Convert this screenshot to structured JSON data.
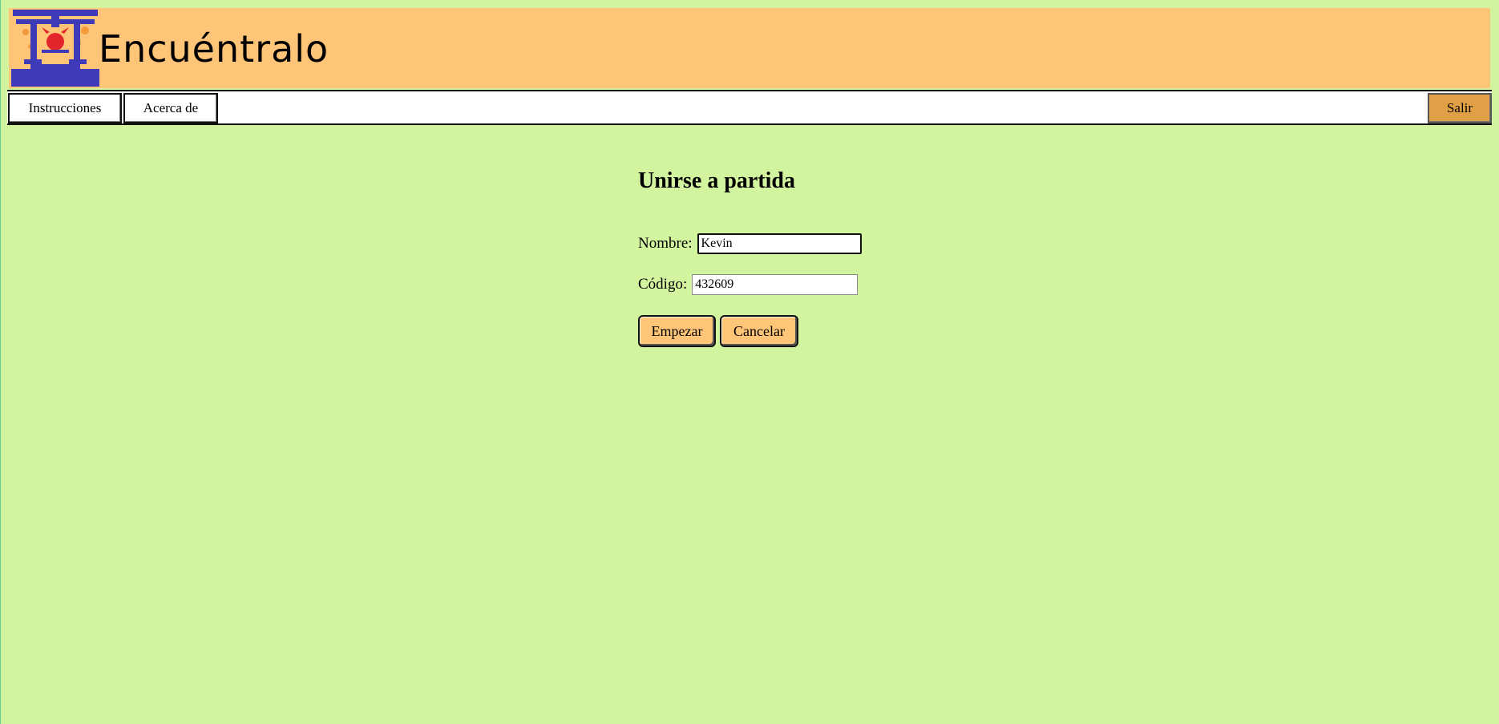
{
  "header": {
    "brand": "Encuéntralo",
    "logo_icon": "torii-gate-logo-icon"
  },
  "nav": {
    "instructions": "Instrucciones",
    "about": "Acerca de",
    "exit": "Salir"
  },
  "form": {
    "title": "Unirse a partida",
    "name_label": "Nombre:",
    "name_value": "Kevin",
    "code_label": "Código:",
    "code_value": "432609",
    "start_label": "Empezar",
    "cancel_label": "Cancelar"
  },
  "colors": {
    "page_bg": "#d2f49f",
    "header_bg": "#fec477",
    "exit_bg": "#e2a046",
    "logo_blue": "#3f3bb8",
    "logo_red": "#e3262c"
  }
}
